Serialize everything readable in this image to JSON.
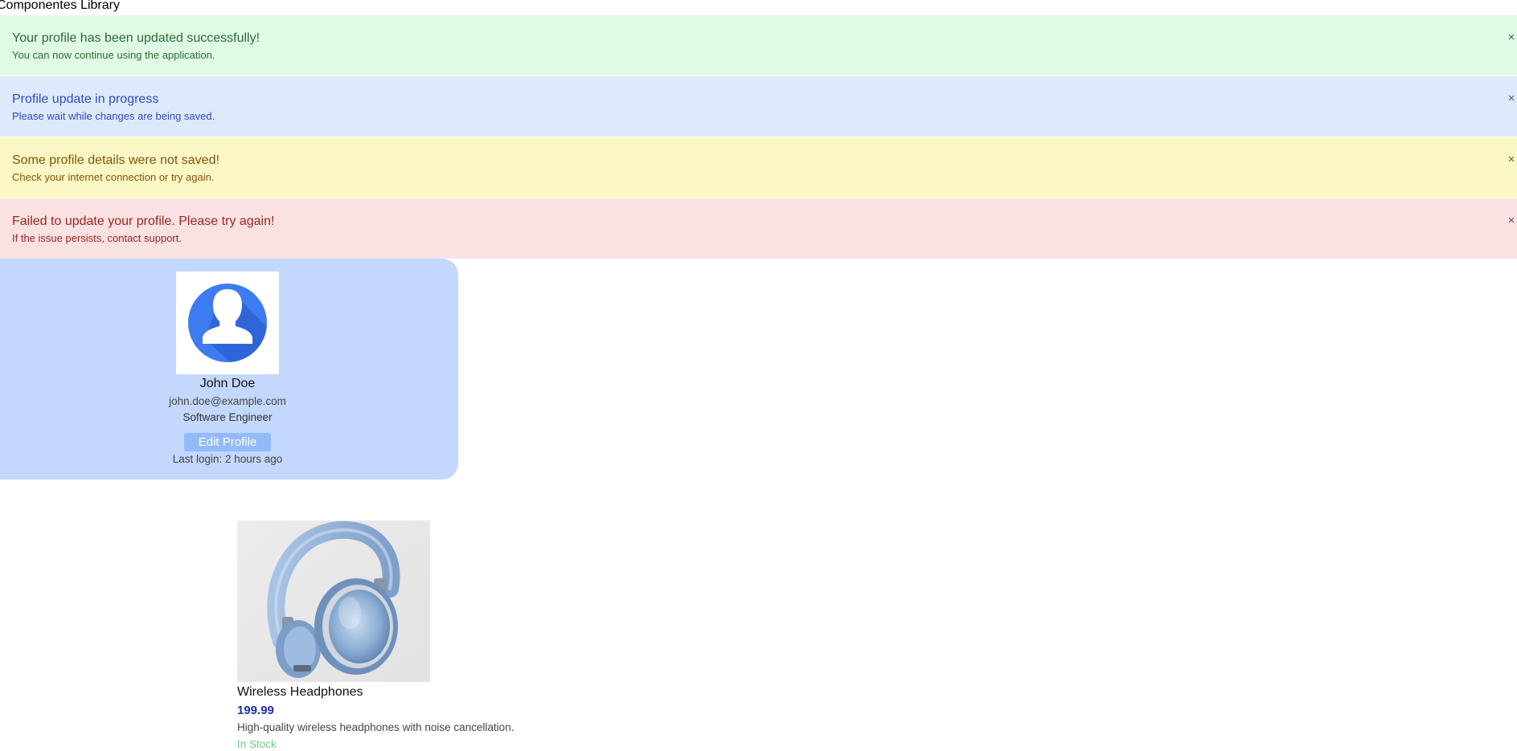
{
  "page": {
    "title": "Componentes Library"
  },
  "alerts": [
    {
      "type": "success",
      "title": "Your profile has been updated successfully!",
      "message": "You can now continue using the application.",
      "close": "×"
    },
    {
      "type": "info",
      "title": "Profile update in progress",
      "message": "Please wait while changes are being saved.",
      "close": "×"
    },
    {
      "type": "warning",
      "title": "Some profile details were not saved!",
      "message": "Check your internet connection or try again.",
      "close": "×"
    },
    {
      "type": "error",
      "title": "Failed to update your profile. Please try again!",
      "message": "If the issue persists, contact support.",
      "close": "×"
    }
  ],
  "profile": {
    "avatar_icon": "user-avatar-icon",
    "name": "John Doe",
    "email": "john.doe@example.com",
    "role": "Software Engineer",
    "edit_label": "Edit Profile",
    "last_login": "Last login: 2 hours ago"
  },
  "product": {
    "image_icon": "headphones-image",
    "name": "Wireless Headphones",
    "price": "199.99",
    "description": "High-quality wireless headphones with noise cancellation.",
    "stock": "In Stock"
  },
  "colors": {
    "success_bg": "#dffbe5",
    "info_bg": "#dee9fc",
    "warning_bg": "#fcf8c6",
    "error_bg": "#fbe2e2",
    "profile_card_bg": "#c4d7fd",
    "edit_button_bg": "#93bafd",
    "price_color": "#1f2fa8",
    "stock_color": "#6ecb84"
  }
}
